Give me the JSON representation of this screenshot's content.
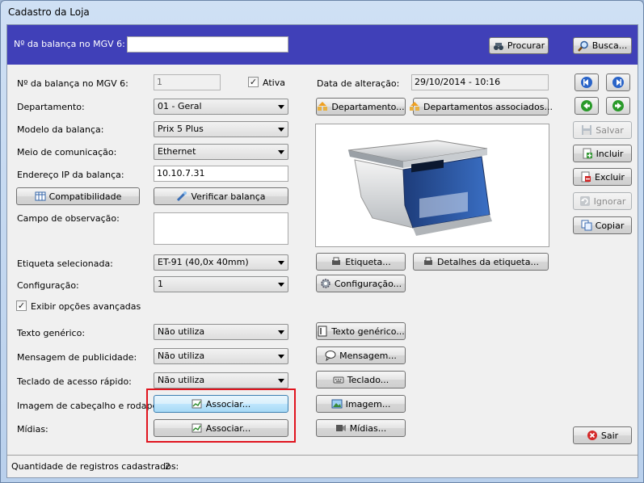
{
  "window": {
    "title": "Cadastro da Loja"
  },
  "header": {
    "label": "Nº da balança no MGV 6:",
    "input_value": "",
    "procurar": "Procurar",
    "busca": "Busca..."
  },
  "form": {
    "numero_label": "Nº da balança no MGV 6:",
    "numero_value": "1",
    "ativa_label": "Ativa",
    "ativa_checked": "✓",
    "data_label": "Data de alteração:",
    "data_value": "29/10/2014 - 10:16",
    "departamento_label": "Departamento:",
    "departamento_value": "01 - Geral",
    "departamento_btn": "Departamento...",
    "dep_assoc_btn": "Departamentos associados...",
    "modelo_label": "Modelo da balança:",
    "modelo_value": "Prix 5 Plus",
    "meio_label": "Meio de comunicação:",
    "meio_value": "Ethernet",
    "ip_label": "Endereço IP da balança:",
    "ip_value": "10.10.7.31",
    "compat_btn": "Compatibilidade",
    "verificar_btn": "Verificar balança",
    "obs_label": "Campo de observação:",
    "obs_value": "",
    "etiqueta_label": "Etiqueta selecionada:",
    "etiqueta_value": "ET-91 (40,0x  40mm)",
    "etiqueta_btn": "Etiqueta...",
    "detalhes_btn": "Detalhes da etiqueta...",
    "config_label": "Configuração:",
    "config_value": "1",
    "config_btn": "Configuração...",
    "avancadas_label": "Exibir opções avançadas",
    "avancadas_checked": "✓",
    "texto_label": "Texto genérico:",
    "texto_value": "Não utiliza",
    "texto_btn": "Texto genérico...",
    "msg_label": "Mensagem de publicidade:",
    "msg_value": "Não utiliza",
    "msg_btn": "Mensagem...",
    "teclado_label": "Teclado de acesso rápido:",
    "teclado_value": "Não utiliza",
    "teclado_btn": "Teclado...",
    "imagem_label": "Imagem de cabeçalho e rodapé:",
    "imagem_assoc": "Associar...",
    "imagem_btn": "Imagem...",
    "midias_label": "Mídias:",
    "midias_assoc": "Associar...",
    "midias_btn": "Mídias..."
  },
  "side": {
    "salvar": "Salvar",
    "incluir": "Incluir",
    "excluir": "Excluir",
    "ignorar": "Ignorar",
    "copiar": "Copiar",
    "sair": "Sair"
  },
  "footer": {
    "label": "Quantidade de registros cadastrados:",
    "count": "2"
  }
}
